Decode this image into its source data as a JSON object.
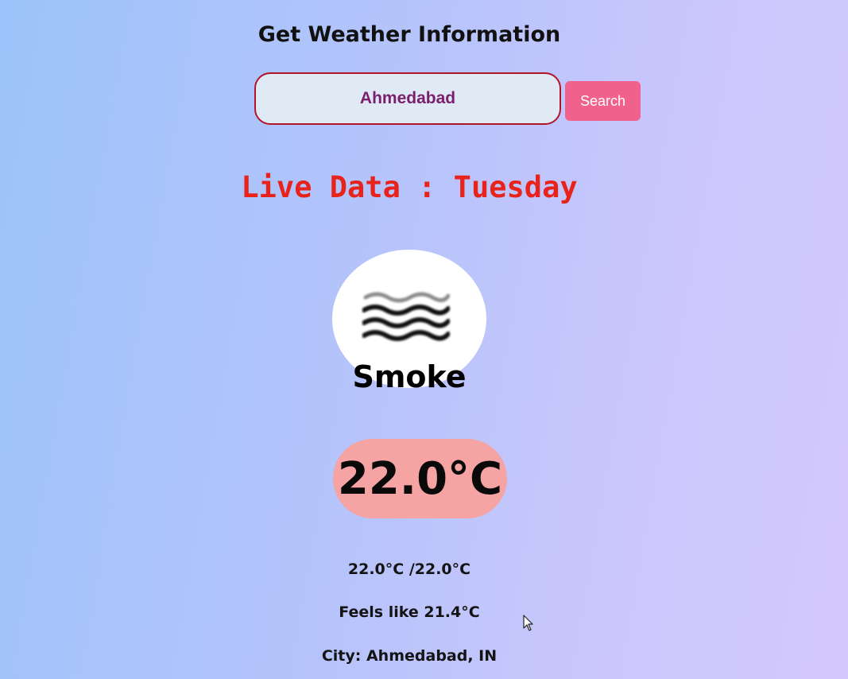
{
  "header": {
    "title": "Get Weather Information"
  },
  "search": {
    "value": "Ahmedabad",
    "button_label": "Search"
  },
  "live": {
    "label": "Live Data : Tuesday"
  },
  "weather": {
    "icon": "smoke-icon",
    "condition": "Smoke",
    "temperature": "22.0°C",
    "min_max": "22.0°C /22.0°C",
    "feels_like": "Feels like 21.4°C",
    "city": "City: Ahmedabad, IN"
  },
  "colors": {
    "live_label": "#e8231c",
    "search_button": "#f0628b",
    "temp_badge": "#f5a3a3",
    "input_border": "#b0162a"
  }
}
